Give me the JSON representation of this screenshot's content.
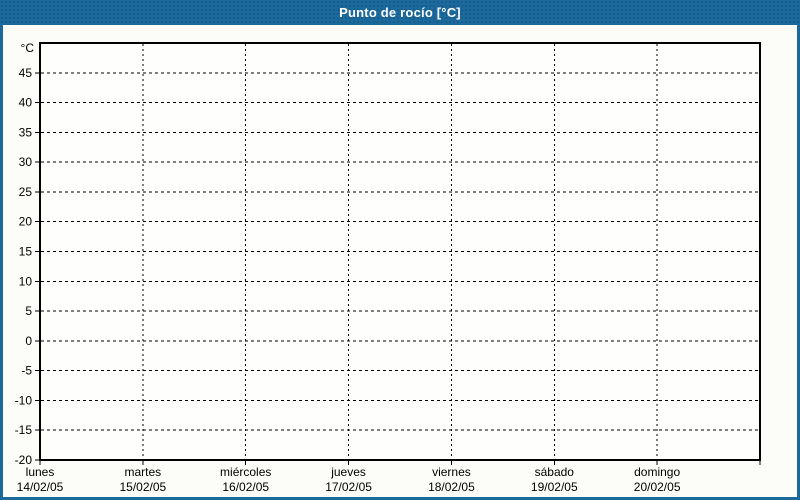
{
  "window": {
    "title": "Punto de rocío [°C]"
  },
  "colors": {
    "titlebar_bg": "#1c699c",
    "title_text": "#ffffff",
    "window_border": "#1c699c",
    "content_bg": "#fcfdf9",
    "plot_bg": "#fefefc",
    "grid_line": "#000000",
    "axis_line": "#000000",
    "label_text": "#000000"
  },
  "chart_data": {
    "type": "line",
    "title": "Punto de rocío [°C]",
    "ylabel": "°C",
    "xlabel": "",
    "ylim": [
      -20,
      50
    ],
    "yticks": [
      45,
      40,
      35,
      30,
      25,
      20,
      15,
      10,
      5,
      0,
      -5,
      -10,
      -15,
      -20
    ],
    "x_categories": [
      "lunes",
      "martes",
      "miércoles",
      "jueves",
      "viernes",
      "sábado",
      "domingo"
    ],
    "x_dates": [
      "14/02/05",
      "15/02/05",
      "16/02/05",
      "17/02/05",
      "18/02/05",
      "19/02/05",
      "20/02/05"
    ],
    "series": [],
    "grid": "dashed",
    "legend": "none"
  }
}
